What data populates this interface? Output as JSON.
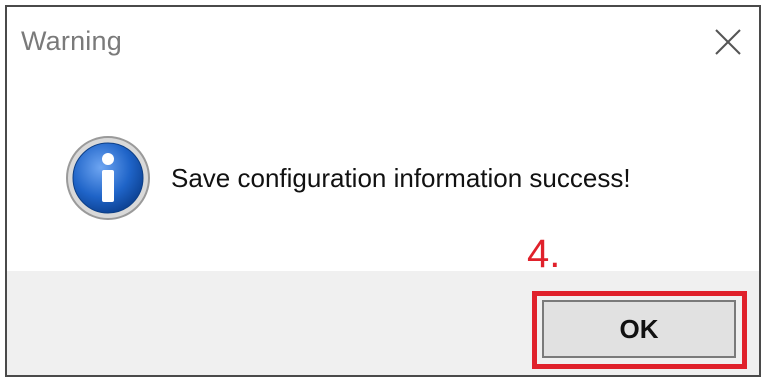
{
  "window": {
    "title": "Warning"
  },
  "icons": {
    "close": "close-icon",
    "info": "information-icon"
  },
  "content": {
    "message": "Save configuration information success!"
  },
  "annotation": {
    "step_label": "4."
  },
  "footer": {
    "ok_label": "OK"
  },
  "colors": {
    "annotation_red": "#e0212b",
    "info_blue": "#1f64c8",
    "footer_bg": "#f0f0f0"
  }
}
